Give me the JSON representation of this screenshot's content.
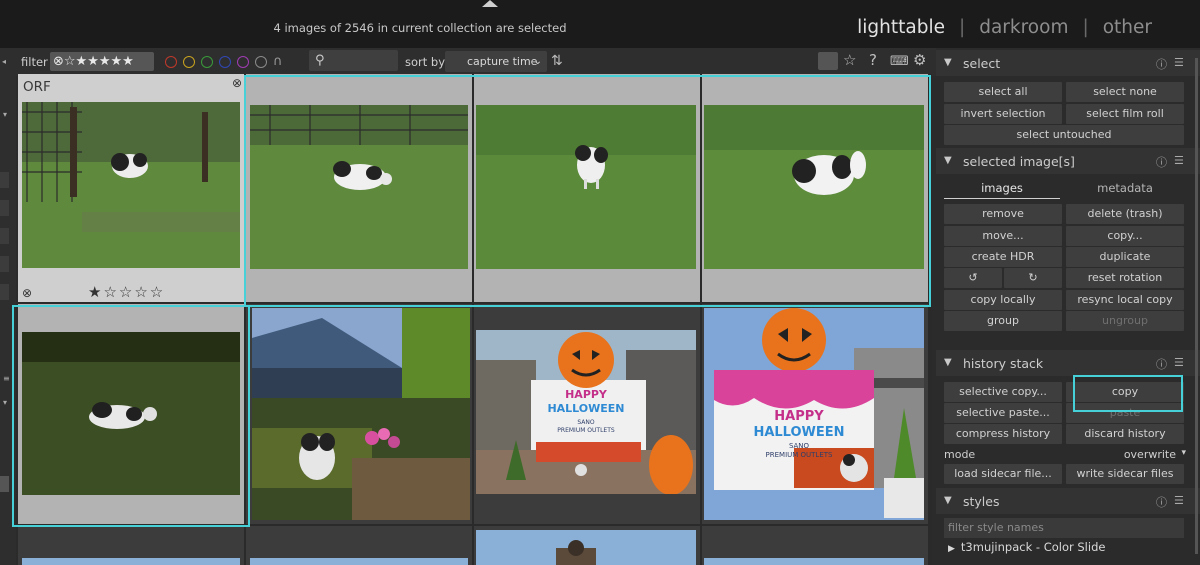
{
  "header": {
    "selection_status": "4 images of 2546 in current collection are selected",
    "views": [
      {
        "label": "lighttable",
        "active": true
      },
      {
        "label": "darkroom",
        "active": false
      },
      {
        "label": "other",
        "active": false
      }
    ],
    "view_separator": "|"
  },
  "filterbar": {
    "filter_label": "filter",
    "rating_filter": "⊗☆★★★★★",
    "color_labels": [
      "#c0392b",
      "#c8a21f",
      "#3a9a3a",
      "#3147b5",
      "#a03cb4",
      "#8a8a8a"
    ],
    "search_placeholder": "",
    "sort_label": "sort by",
    "sort_value": "capture time"
  },
  "thumbnails": [
    {
      "ext": "ORF",
      "rating": "★☆☆☆☆",
      "selected": false,
      "hovered": true
    },
    {
      "selected": true
    },
    {
      "selected": true
    },
    {
      "selected": true
    },
    {
      "selected": true
    },
    {
      "selected": false
    },
    {
      "selected": false
    },
    {
      "selected": false
    }
  ],
  "thumb_text": {
    "halloween_line1": "HAPPY",
    "halloween_line2": "HALLOWEEN",
    "outlets_line1": "SANO",
    "outlets_line2": "PREMIUM OUTLETS"
  },
  "right_panel": {
    "select": {
      "title": "select",
      "buttons": [
        "select all",
        "select none",
        "invert selection",
        "select film roll",
        "select untouched"
      ]
    },
    "selected_images": {
      "title": "selected image[s]",
      "tabs": [
        {
          "label": "images",
          "active": true
        },
        {
          "label": "metadata",
          "active": false
        }
      ],
      "buttons": [
        "remove",
        "delete (trash)",
        "move...",
        "copy...",
        "create HDR",
        "duplicate",
        "reset rotation",
        "copy locally",
        "resync local copy",
        "group",
        "ungroup"
      ]
    },
    "history_stack": {
      "title": "history stack",
      "buttons": [
        "selective copy...",
        "copy",
        "selective paste...",
        "paste",
        "compress history",
        "discard history",
        "load sidecar file...",
        "write sidecar files"
      ],
      "mode_label": "mode",
      "mode_value": "overwrite"
    },
    "styles": {
      "title": "styles",
      "filter_placeholder": "filter style names",
      "items": [
        "t3mujinpack - Color Slide"
      ]
    }
  },
  "highlight_color": "#46d0d8"
}
